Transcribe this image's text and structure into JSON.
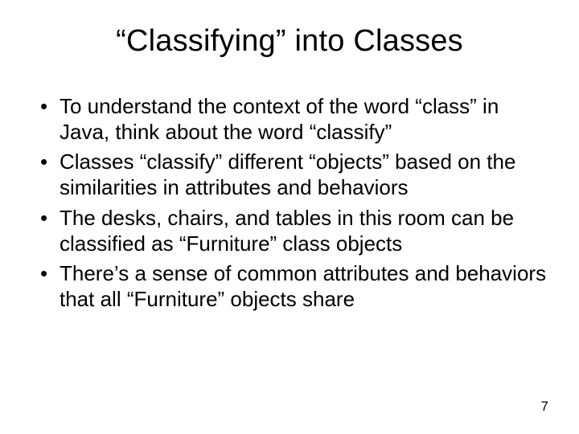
{
  "title": "“Classifying” into Classes",
  "bullets": [
    "To understand the context of the word “class” in Java, think about the word “classify”",
    "Classes “classify” different “objects” based on the similarities in attributes and behaviors",
    "The desks, chairs, and tables in this room can be classified as “Furniture” class objects",
    "There’s a sense of common attributes and behaviors that all “Furniture” objects share"
  ],
  "page_number": "7"
}
